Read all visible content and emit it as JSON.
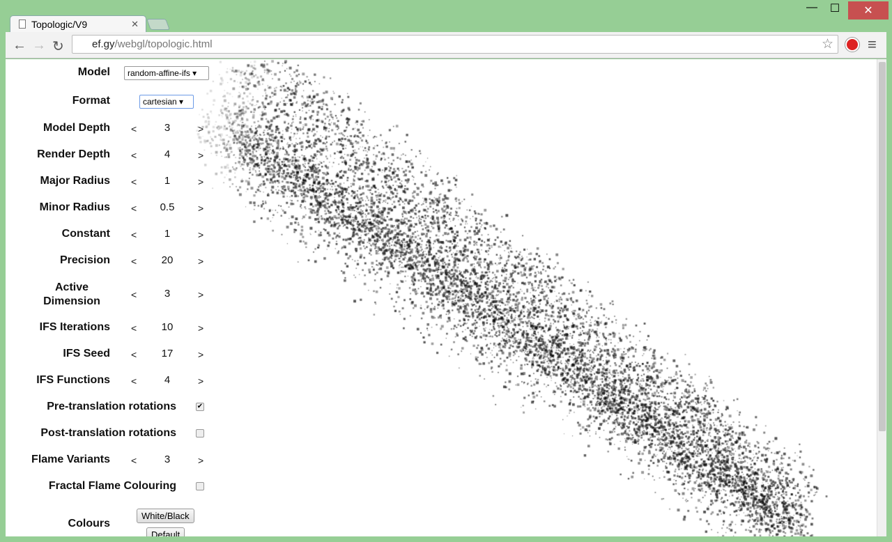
{
  "window": {
    "tab_title": "Topologic/V9",
    "minimize": "—",
    "maximize": "☐",
    "close": "✕",
    "close_color": "#c75050"
  },
  "toolbar": {
    "url_host": "ef.gy",
    "url_path": "/webgl/topologic.html",
    "back": "←",
    "forward": "→",
    "reload": "↻",
    "star": "☆",
    "menu": "≡"
  },
  "controls": {
    "model": {
      "label": "Model",
      "value": "random-affine-ifs"
    },
    "format": {
      "label": "Format",
      "value": "cartesian"
    },
    "steppers": [
      {
        "label": "Model Depth",
        "value": "3"
      },
      {
        "label": "Render Depth",
        "value": "4"
      },
      {
        "label": "Major Radius",
        "value": "1"
      },
      {
        "label": "Minor Radius",
        "value": "0.5"
      },
      {
        "label": "Constant",
        "value": "1"
      },
      {
        "label": "Precision",
        "value": "20"
      },
      {
        "label": "Active Dimension",
        "value": "3"
      },
      {
        "label": "IFS Iterations",
        "value": "10"
      },
      {
        "label": "IFS Seed",
        "value": "17"
      },
      {
        "label": "IFS Functions",
        "value": "4"
      }
    ],
    "pre_rotations": {
      "label": "Pre-translation rotations",
      "checked": true
    },
    "post_rotations": {
      "label": "Post-translation rotations",
      "checked": false
    },
    "flame_variants": {
      "label": "Flame Variants",
      "value": "3"
    },
    "flame_colouring": {
      "label": "Fractal Flame Colouring",
      "checked": false
    },
    "colours": {
      "label": "Colours",
      "button1": "White/Black",
      "button2": "Default"
    },
    "prev": "<",
    "next": ">",
    "check": "✔"
  }
}
